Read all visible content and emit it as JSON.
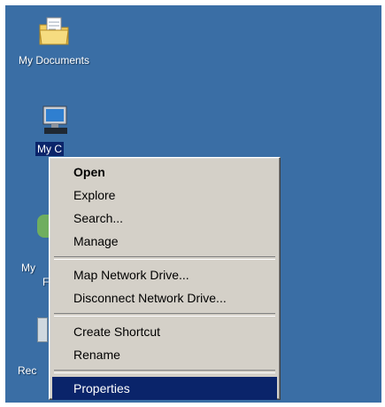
{
  "desktop": {
    "background_color": "#3a6ea5",
    "icons": [
      {
        "label": "My Documents",
        "icon": "folder-documents-icon"
      },
      {
        "label": "My C",
        "icon": "computer-icon"
      },
      {
        "label": "My",
        "label2": "F",
        "icon": "network-places-icon"
      },
      {
        "label": "Rec",
        "icon": "recycle-bin-icon"
      }
    ]
  },
  "context_menu": {
    "selection_color": "#0a246a",
    "items": [
      {
        "label": "Open",
        "bold": true
      },
      {
        "label": "Explore"
      },
      {
        "label": "Search..."
      },
      {
        "label": "Manage"
      },
      {
        "label": "Map Network Drive..."
      },
      {
        "label": "Disconnect Network Drive..."
      },
      {
        "label": "Create Shortcut"
      },
      {
        "label": "Rename"
      },
      {
        "label": "Properties",
        "selected": true
      }
    ]
  }
}
